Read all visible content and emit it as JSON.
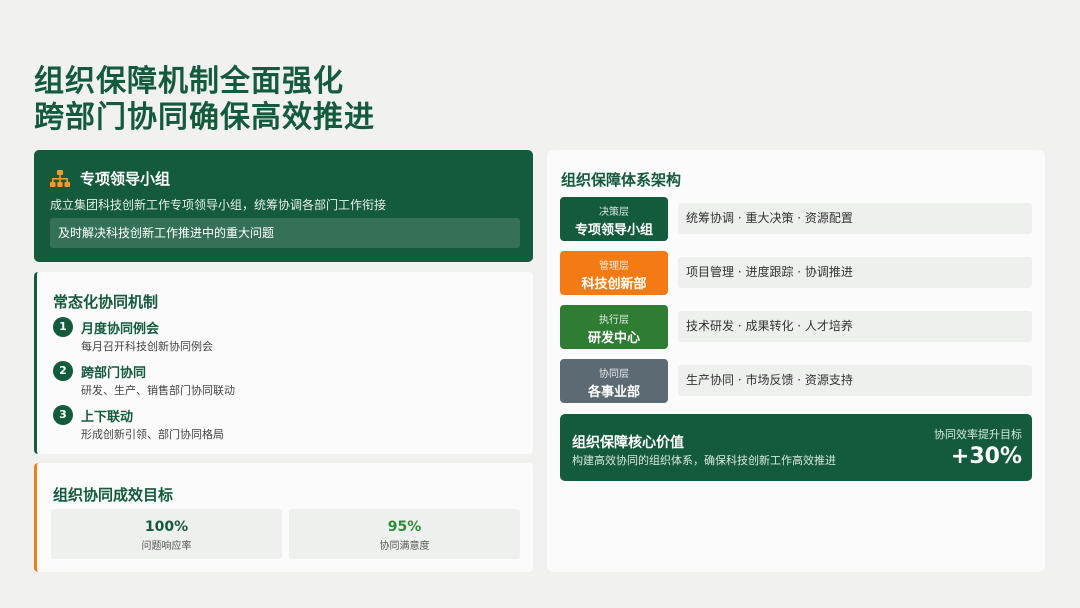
{
  "title": {
    "line1": "组织保障机制全面强化",
    "line2": "跨部门协同确保高效推进"
  },
  "leadership": {
    "icon": "org-chart-icon",
    "title": "专项领导小组",
    "desc": "成立集团科技创新工作专项领导小组，统筹协调各部门工作衔接",
    "highlight": "及时解决科技创新工作推进中的重大问题"
  },
  "mechanism": {
    "title": "常态化协同机制",
    "items": [
      {
        "num": "1",
        "title": "月度协同例会",
        "sub": "每月召开科技创新协同例会"
      },
      {
        "num": "2",
        "title": "跨部门协同",
        "sub": "研发、生产、销售部门协同联动"
      },
      {
        "num": "3",
        "title": "上下联动",
        "sub": "形成创新引领、部门协同格局"
      }
    ]
  },
  "goals": {
    "title": "组织协同成效目标",
    "metrics": [
      {
        "value": "100%",
        "label": "问题响应率",
        "color": "#145a3c"
      },
      {
        "value": "95%",
        "label": "协同满意度",
        "color": "#2e8b3a"
      }
    ]
  },
  "architecture": {
    "title": "组织保障体系架构",
    "layers": [
      {
        "level": "决策层",
        "name": "专项领导小组",
        "desc": "统筹协调 · 重大决策 · 资源配置",
        "color": "#145a3c"
      },
      {
        "level": "管理层",
        "name": "科技创新部",
        "desc": "项目管理 · 进度跟踪 · 协调推进",
        "color": "#f47b14"
      },
      {
        "level": "执行层",
        "name": "研发中心",
        "desc": "技术研发 · 成果转化 · 人才培养",
        "color": "#2e7d32"
      },
      {
        "level": "协同层",
        "name": "各事业部",
        "desc": "生产协同 · 市场反馈 · 资源支持",
        "color": "#5c6b73"
      }
    ],
    "core": {
      "title": "组织保障核心价值",
      "desc": "构建高效协同的组织体系，确保科技创新工作高效推进",
      "goal_label": "协同效率提升目标",
      "goal_value": "+30%"
    }
  }
}
